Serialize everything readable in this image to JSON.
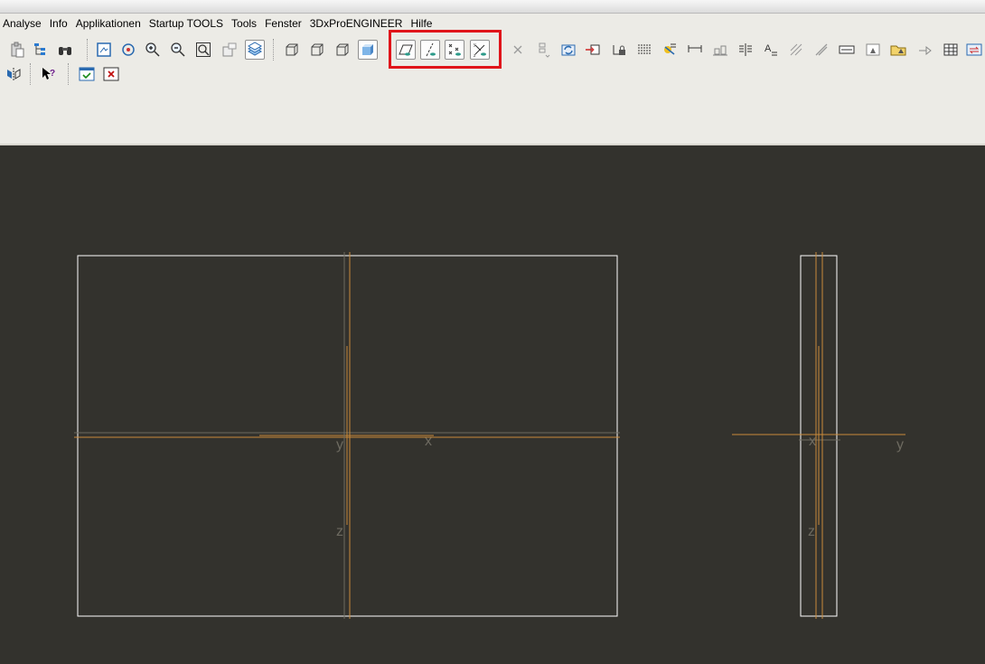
{
  "menu": {
    "items": [
      "Analyse",
      "Info",
      "Applikationen",
      "Startup TOOLS",
      "Tools",
      "Fenster",
      "3DxProENGINEER",
      "Hilfe"
    ]
  },
  "toolbar": {
    "row1_icons": [
      "clipboard-icon",
      "tree-icon",
      "binoculars-icon",
      "repaint-icon",
      "spin-center-icon",
      "zoom-in-icon",
      "zoom-out-icon",
      "refit-icon",
      "view-manager-icon",
      "layers-icon",
      "wireframe-icon",
      "hidden-line-icon",
      "no-hidden-icon",
      "shading-icon",
      "datum-planes-icon",
      "datum-axes-icon",
      "datum-points-icon",
      "coordinate-systems-icon",
      "delete-icon",
      "show-icon",
      "regenerate-icon",
      "reference-icon",
      "lock-icon",
      "table-icon",
      "note-icon",
      "dimension-icon",
      "align-icon",
      "break-icon",
      "text-style-icon",
      "hatch-icon",
      "slash-icon",
      "scale-icon",
      "hide-icon",
      "folder-icon",
      "move-icon",
      "grid-table-icon",
      "swap-icon"
    ],
    "row2_icons": [
      "mirror-icon",
      "whats-this-icon",
      "window-activate-icon",
      "window-close-icon"
    ],
    "highlighted_group": "datum-display-toggles",
    "highlight_color": "#e0141a"
  },
  "drawing": {
    "background": "#33322d",
    "outline_color": "#ffffff",
    "axis_color": "#c98a3a",
    "label_color": "#6d6a60",
    "front_view_labels": {
      "y": "y",
      "x": "x",
      "z": "z"
    },
    "side_view_labels": {
      "x": "x",
      "y": "y",
      "z": "z"
    }
  }
}
